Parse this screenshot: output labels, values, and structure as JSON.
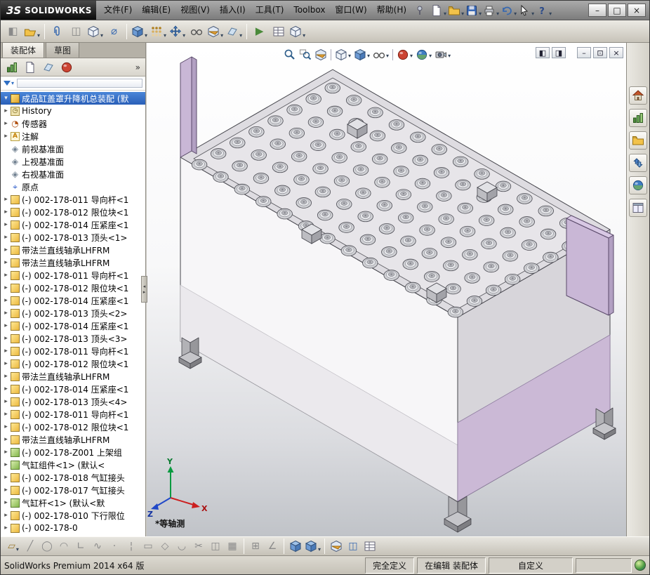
{
  "colors": {
    "selection": "#2e62be",
    "accent_purple": "#c9b7d6",
    "titlebar_dark": "#0d0d0d"
  },
  "titlebar": {
    "logo_prefix": "3S",
    "logo": "SOLIDWORKS",
    "menus": [
      "文件(F)",
      "编辑(E)",
      "视图(V)",
      "插入(I)",
      "工具(T)",
      "Toolbox",
      "窗口(W)",
      "帮助(H)"
    ],
    "pin": {
      "name": "menu-pin-icon",
      "type": "pin"
    },
    "quick_icons": [
      {
        "name": "new-document-icon",
        "type": "page",
        "dd": true
      },
      {
        "name": "open-document-icon",
        "type": "folder",
        "dd": true
      },
      {
        "name": "save-icon",
        "type": "disk",
        "dd": true
      },
      {
        "name": "print-icon",
        "type": "printer",
        "dd": true
      },
      {
        "name": "undo-icon",
        "type": "undo",
        "dd": true
      },
      {
        "name": "select-cursor-icon",
        "type": "cursor",
        "dd": true
      },
      {
        "name": "help-icon",
        "type": "question",
        "dd": true
      }
    ],
    "window_controls": [
      {
        "name": "minimize-button",
        "glyph": "–"
      },
      {
        "name": "maximize-button",
        "glyph": "□"
      },
      {
        "name": "close-button",
        "glyph": "×"
      }
    ]
  },
  "main_toolbar": {
    "icons": [
      {
        "name": "edit-component-icon",
        "glyph": "◧",
        "color": "#8a8a8a"
      },
      {
        "name": "open-with-icon",
        "type": "folder-open",
        "dd": true
      },
      {
        "sep": true
      },
      {
        "name": "mate-icon",
        "type": "clip"
      },
      {
        "name": "component-preview-icon",
        "glyph": "◫",
        "color": "#8a8a8a"
      },
      {
        "name": "insert-items-icon",
        "type": "cube",
        "dd": true
      },
      {
        "name": "smart-fasteners-icon",
        "glyph": "⌀",
        "color": "#3a6ab0"
      },
      {
        "sep": true
      },
      {
        "name": "insert-component-icon",
        "type": "cube-shaded",
        "dd": true
      },
      {
        "name": "linear-pattern-icon",
        "type": "pattern",
        "dd": true
      },
      {
        "name": "move-component-icon",
        "type": "move",
        "dd": true
      },
      {
        "name": "show-hidden-components-icon",
        "type": "glasses"
      },
      {
        "name": "assembly-features-icon",
        "type": "cube-section",
        "dd": true
      },
      {
        "name": "reference-geometry-icon",
        "type": "plane",
        "dd": true
      },
      {
        "sep": true
      },
      {
        "name": "motion-study-icon",
        "glyph": "▶",
        "color": "#4a8a3a"
      },
      {
        "name": "bom-table-icon",
        "type": "table"
      },
      {
        "name": "exploded-view-icon",
        "type": "cube",
        "dd": true
      }
    ]
  },
  "left_panel": {
    "tabs": [
      {
        "id": "tab-assembly",
        "label": "装配体",
        "active": true
      },
      {
        "id": "tab-sketch",
        "label": "草图",
        "active": false
      }
    ],
    "manager_tabs": [
      {
        "name": "feature-manager-tab",
        "type": "bars"
      },
      {
        "name": "property-manager-tab",
        "type": "page"
      },
      {
        "name": "configuration-manager-tab",
        "type": "plane"
      },
      {
        "name": "display-manager-tab",
        "type": "sphere"
      }
    ],
    "overflow": "»",
    "tree": [
      {
        "i": "assembly",
        "l": "成品缸盖罩升降机总装配 (默",
        "a": "o",
        "s": true
      },
      {
        "i": "history",
        "l": "History",
        "a": "c"
      },
      {
        "i": "sensors",
        "l": "传感器",
        "a": "c"
      },
      {
        "i": "annotations",
        "l": "注解",
        "a": "c"
      },
      {
        "i": "plane",
        "l": "前视基准面",
        "a": ""
      },
      {
        "i": "plane",
        "l": "上视基准面",
        "a": ""
      },
      {
        "i": "plane",
        "l": "右视基准面",
        "a": ""
      },
      {
        "i": "origin",
        "l": "原点",
        "a": ""
      },
      {
        "i": "part",
        "l": "(-) 002-178-011 导向杆<1",
        "a": "c"
      },
      {
        "i": "part",
        "l": "(-) 002-178-012 限位块<1",
        "a": "c"
      },
      {
        "i": "part",
        "l": "(-) 002-178-014 压紧座<1",
        "a": "c"
      },
      {
        "i": "part",
        "l": "(-) 002-178-013 顶头<1>",
        "a": "c"
      },
      {
        "i": "part",
        "l": "带法兰直线轴承LHFRM",
        "a": "c"
      },
      {
        "i": "part",
        "l": "带法兰直线轴承LHFRM",
        "a": "c"
      },
      {
        "i": "part",
        "l": "(-) 002-178-011 导向杆<1",
        "a": "c"
      },
      {
        "i": "part",
        "l": "(-) 002-178-012 限位块<1",
        "a": "c"
      },
      {
        "i": "part",
        "l": "(-) 002-178-014 压紧座<1",
        "a": "c"
      },
      {
        "i": "part",
        "l": "(-) 002-178-013 顶头<2>",
        "a": "c"
      },
      {
        "i": "part",
        "l": "(-) 002-178-014 压紧座<1",
        "a": "c"
      },
      {
        "i": "part",
        "l": "(-) 002-178-013 顶头<3>",
        "a": "c"
      },
      {
        "i": "part",
        "l": "(-) 002-178-011 导向杆<1",
        "a": "c"
      },
      {
        "i": "part",
        "l": "(-) 002-178-012 限位块<1",
        "a": "c"
      },
      {
        "i": "part",
        "l": "带法兰直线轴承LHFRM",
        "a": "c"
      },
      {
        "i": "part",
        "l": "(-) 002-178-014 压紧座<1",
        "a": "c"
      },
      {
        "i": "part",
        "l": "(-) 002-178-013 顶头<4>",
        "a": "c"
      },
      {
        "i": "part",
        "l": "(-) 002-178-011 导向杆<1",
        "a": "c"
      },
      {
        "i": "part",
        "l": "(-) 002-178-012 限位块<1",
        "a": "c"
      },
      {
        "i": "part",
        "l": "带法兰直线轴承LHFRM",
        "a": "c"
      },
      {
        "i": "subasm",
        "l": "(-) 002-178-Z001 上架组",
        "a": "c"
      },
      {
        "i": "subasm",
        "l": "气缸组件<1> (默认<",
        "a": "c"
      },
      {
        "i": "part",
        "l": "(-) 002-178-018 气缸接头",
        "a": "c"
      },
      {
        "i": "part",
        "l": "(-) 002-178-017 气缸接头",
        "a": "c"
      },
      {
        "i": "subasm",
        "l": "气缸杆<1> (默认<默",
        "a": "c"
      },
      {
        "i": "part",
        "l": "(-) 002-178-010 下行限位",
        "a": "c"
      },
      {
        "i": "part",
        "l": "(-) 002-178-0",
        "a": "c"
      }
    ]
  },
  "viewport": {
    "headsup": [
      {
        "name": "zoom-fit-icon",
        "type": "magnifier"
      },
      {
        "name": "zoom-area-icon",
        "type": "magnifier-area"
      },
      {
        "name": "section-view-icon",
        "type": "cube-section"
      },
      {
        "sep": true
      },
      {
        "name": "view-orientation-icon",
        "type": "cube",
        "dd": true
      },
      {
        "name": "display-style-icon",
        "type": "cube-shaded",
        "dd": true
      },
      {
        "name": "hide-show-items-icon",
        "type": "glasses",
        "dd": true
      },
      {
        "sep": true
      },
      {
        "name": "edit-appearance-icon",
        "type": "sphere",
        "dd": true
      },
      {
        "name": "apply-scene-icon",
        "type": "sphere-blue",
        "dd": true
      },
      {
        "name": "view-settings-icon",
        "type": "camera",
        "dd": true
      }
    ],
    "doc_controls": [
      {
        "name": "pane-left-button",
        "glyph": "◧"
      },
      {
        "name": "pane-right-button",
        "glyph": "◨"
      },
      {
        "gap": true
      },
      {
        "name": "doc-minimize-button",
        "glyph": "–"
      },
      {
        "name": "doc-restore-button",
        "glyph": "⊡"
      },
      {
        "name": "doc-close-button",
        "glyph": "×"
      }
    ],
    "view_label": "*等轴测",
    "triad": {
      "x": "X",
      "y": "Y",
      "z": "Z"
    }
  },
  "task_pane": [
    {
      "name": "solidworks-resources-icon",
      "type": "house"
    },
    {
      "name": "design-library-icon",
      "type": "bars"
    },
    {
      "name": "file-explorer-icon",
      "type": "folder"
    },
    {
      "name": "view-palette-icon",
      "type": "arrows"
    },
    {
      "name": "appearances-icon",
      "type": "sphere-blue"
    },
    {
      "name": "custom-properties-icon",
      "type": "panel"
    }
  ],
  "bottom_toolbar": [
    {
      "name": "sketch-icon",
      "glyph": "▱",
      "color": "#9a7a30",
      "dd": true
    },
    {
      "name": "line-icon",
      "glyph": "╱",
      "color": "#8a8a8a"
    },
    {
      "name": "circle-icon",
      "glyph": "◯",
      "color": "#8a8a8a"
    },
    {
      "name": "arc-icon",
      "glyph": "◠",
      "color": "#8a8a8a"
    },
    {
      "name": "polyline-icon",
      "glyph": "∟",
      "color": "#8a8a8a"
    },
    {
      "name": "spline-icon",
      "glyph": "∿",
      "color": "#8a8a8a"
    },
    {
      "name": "point-icon",
      "glyph": "·",
      "color": "#8a8a8a"
    },
    {
      "name": "centerline-icon",
      "glyph": "¦",
      "color": "#8a8a8a"
    },
    {
      "name": "rectangle-icon",
      "glyph": "▭",
      "color": "#8a8a8a"
    },
    {
      "name": "polygon-icon",
      "glyph": "◇",
      "color": "#8a8a8a"
    },
    {
      "name": "fillet-icon",
      "glyph": "◡",
      "color": "#8a8a8a"
    },
    {
      "name": "trim-icon",
      "glyph": "✂",
      "color": "#8a8a8a"
    },
    {
      "name": "mirror-icon",
      "glyph": "◫",
      "color": "#8a8a8a"
    },
    {
      "name": "pattern-icon",
      "glyph": "▦",
      "color": "#8a8a8a"
    },
    {
      "sep": true
    },
    {
      "name": "grid-icon",
      "glyph": "⊞",
      "color": "#8a8a8a"
    },
    {
      "name": "angle-snap-icon",
      "glyph": "∠",
      "color": "#8a8a8a"
    },
    {
      "sep": true
    },
    {
      "name": "shaded-view-icon",
      "type": "cube-shaded"
    },
    {
      "name": "display-mode-icon",
      "type": "cube-shaded",
      "dd": true
    },
    {
      "sep": true
    },
    {
      "name": "section-tool-icon",
      "type": "cube-section"
    },
    {
      "name": "split-panes-icon",
      "glyph": "◫",
      "color": "#3a6ab0"
    },
    {
      "name": "evaluate-table-icon",
      "type": "table"
    }
  ],
  "status_bar": {
    "app": "SolidWorks Premium 2014 x64 版",
    "define_state": "完全定义",
    "edit_state": "在编辑 装配体",
    "custom": "自定义"
  }
}
